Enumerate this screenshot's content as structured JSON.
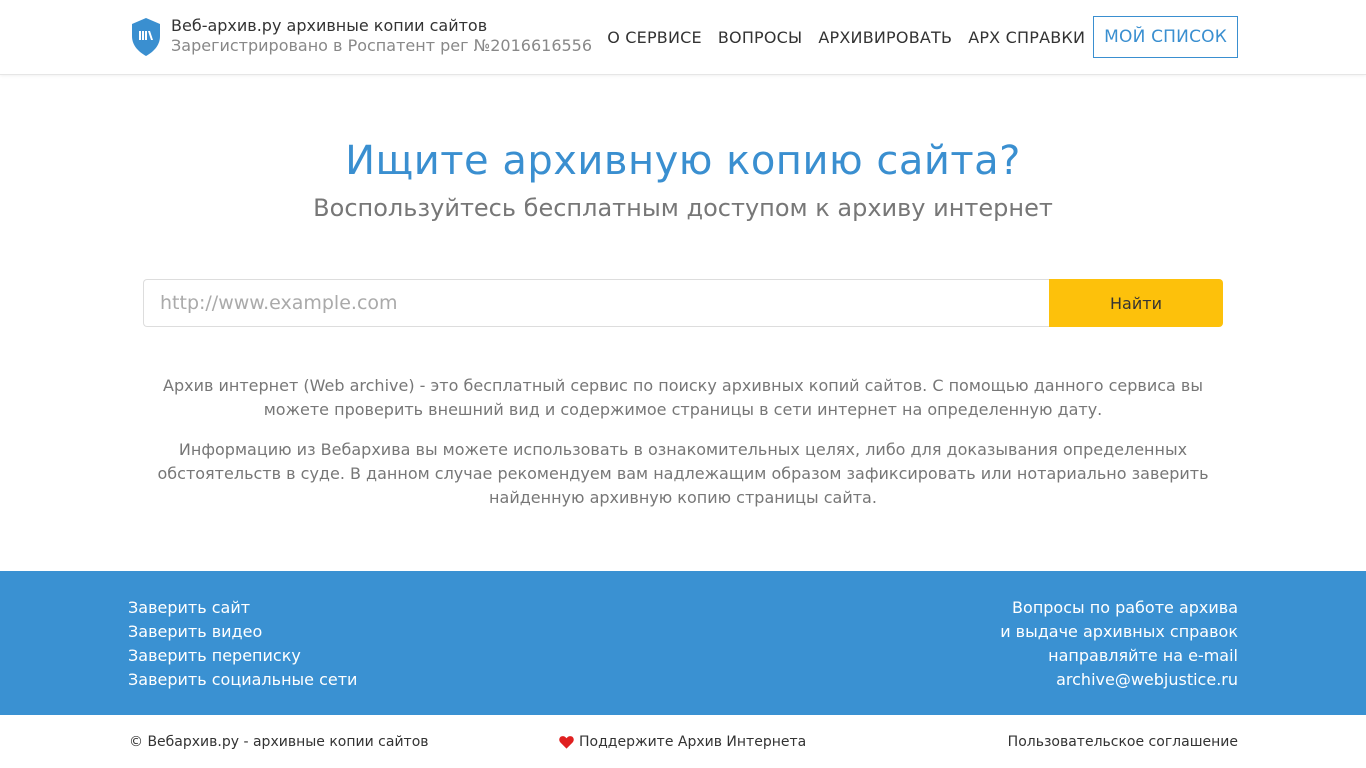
{
  "header": {
    "brand_title": "Веб-архив.ру архивные копии сайтов",
    "brand_subtitle": "Зарегистрировано в Роспатент рег №2016616556",
    "nav": {
      "about": "О СЕРВИСЕ",
      "questions": "ВОПРОСЫ",
      "archive": "АРХИВИРОВАТЬ",
      "references": "АРХ СПРАВКИ",
      "my_list": "МОЙ СПИСОК"
    }
  },
  "hero": {
    "title": "Ищите архивную копию сайта?",
    "subtitle": "Воспользуйтесь бесплатным доступом к архиву интернет"
  },
  "search": {
    "placeholder": "http://www.example.com",
    "value": "",
    "button_label": "Найти"
  },
  "description": {
    "p1": "Архив интернет (Web archive) - это бесплатный сервис по поиску архивных копий сайтов. С помощью данного сервиса вы можете проверить внешний вид и содержимое страницы в сети интернет на определенную дату.",
    "p2": "Информацию из Вебархива вы можете использовать в ознакомительных целях, либо для доказывания определенных обстоятельств в суде. В данном случае рекомендуем вам надлежащим образом зафиксировать или нотариально заверить найденную архивную копию страницы сайта."
  },
  "footer": {
    "links": [
      "Заверить сайт",
      "Заверить видео",
      "Заверить переписку",
      "Заверить социальные сети"
    ],
    "contact": {
      "line1": "Вопросы по работе архива",
      "line2": "и выдаче архивных справок",
      "line3": "направляйте на e-mail",
      "email": "archive@webjustice.ru"
    },
    "copyright": "© Вебархив.ру - архивные копии сайтов",
    "support": "Поддержите Архив Интернета",
    "terms": "Пользовательское соглашение"
  },
  "icons": {
    "logo": "shield-logo-icon",
    "heart": "heart-icon"
  },
  "colors": {
    "accent": "#3a8fd0",
    "footer_bg": "#3a91d2",
    "button_bg": "#fdc10b",
    "heart": "#e02020"
  }
}
